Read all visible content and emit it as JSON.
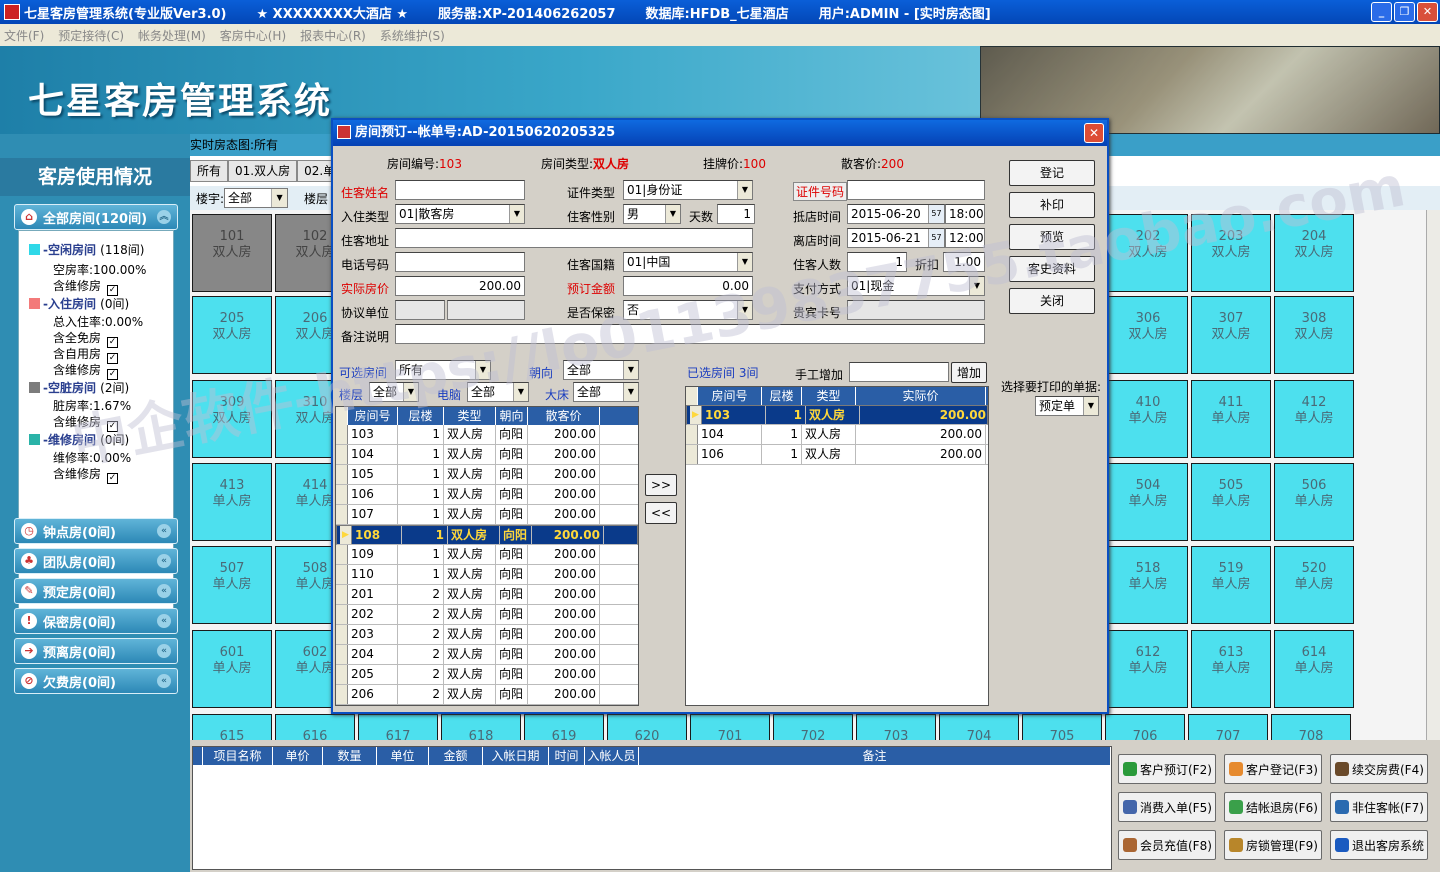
{
  "window": {
    "app_title": "七星客房管理系统(专业版Ver3.0)",
    "hotel": "★ XXXXXXXX大酒店 ★",
    "server": "服务器:XP-201406262057",
    "database": "数据库:HFDB_七星酒店",
    "user": "用户:ADMIN - [实时房态图]",
    "min": "_",
    "max": "❐",
    "close": "✕"
  },
  "menu": [
    "文件(F)",
    "预定接待(C)",
    "帐务处理(M)",
    "客房中心(H)",
    "报表中心(R)",
    "系统维护(S)"
  ],
  "banner_title": "七星客房管理系统",
  "sidebar": {
    "header": "客房使用情况",
    "all_rooms": "全部房间(120间)",
    "stats": {
      "vacant": "-空闲房间",
      "vacant_count": "(118间)",
      "vacant_rate": "空房率:100.00%",
      "vacant_repair": "含维修房",
      "occupied": "-入住房间",
      "occupied_count": "(0间)",
      "occupied_rate": "总入住率:0.00%",
      "free": "含全免房",
      "self": "含自用房",
      "occ_repair": "含维修房",
      "dirty": "-空脏房间",
      "dirty_count": "(2间)",
      "dirty_rate": "脏房率:1.67%",
      "dirty_repair": "含维修房",
      "repair": "-维修房间",
      "repair_count": "(0间)",
      "repair_rate": "维修率:0.00%",
      "repair_repair": "含维修房"
    },
    "groups": [
      "钟点房(0间)",
      "团队房(0间)",
      "预定房(0间)",
      "保密房(0间)",
      "预离房(0间)",
      "欠费房(0间)"
    ]
  },
  "main": {
    "crumb": "实时房态图:所有",
    "tabs": [
      "所有",
      "01.双人房",
      "02.单"
    ],
    "building_label": "楼宇:",
    "building_value": "全部",
    "floor_label": "楼层"
  },
  "rooms": [
    {
      "no": "101",
      "type": "双人房"
    },
    {
      "no": "102",
      "type": "双人房"
    },
    {
      "no": "202",
      "type": "双人房"
    },
    {
      "no": "203",
      "type": "双人房"
    },
    {
      "no": "204",
      "type": "双人房"
    },
    {
      "no": "205",
      "type": "双人房"
    },
    {
      "no": "206",
      "type": "双人房"
    },
    {
      "no": "306",
      "type": "双人房"
    },
    {
      "no": "307",
      "type": "双人房"
    },
    {
      "no": "308",
      "type": "双人房"
    },
    {
      "no": "309",
      "type": "双人房"
    },
    {
      "no": "310",
      "type": "双人房"
    },
    {
      "no": "410",
      "type": "单人房"
    },
    {
      "no": "411",
      "type": "单人房"
    },
    {
      "no": "412",
      "type": "单人房"
    },
    {
      "no": "413",
      "type": "单人房"
    },
    {
      "no": "414",
      "type": "单人房"
    },
    {
      "no": "504",
      "type": "单人房"
    },
    {
      "no": "505",
      "type": "单人房"
    },
    {
      "no": "506",
      "type": "单人房"
    },
    {
      "no": "507",
      "type": "单人房"
    },
    {
      "no": "508",
      "type": "单人房"
    },
    {
      "no": "518",
      "type": "单人房"
    },
    {
      "no": "519",
      "type": "单人房"
    },
    {
      "no": "520",
      "type": "单人房"
    },
    {
      "no": "601",
      "type": "单人房"
    },
    {
      "no": "602",
      "type": "单人房"
    },
    {
      "no": "612",
      "type": "单人房"
    },
    {
      "no": "613",
      "type": "单人房"
    },
    {
      "no": "614",
      "type": "单人房"
    },
    {
      "no": "615",
      "type": ""
    },
    {
      "no": "616",
      "type": ""
    },
    {
      "no": "617",
      "type": ""
    },
    {
      "no": "618",
      "type": ""
    },
    {
      "no": "619",
      "type": ""
    },
    {
      "no": "620",
      "type": ""
    },
    {
      "no": "701",
      "type": ""
    },
    {
      "no": "702",
      "type": ""
    },
    {
      "no": "703",
      "type": ""
    },
    {
      "no": "704",
      "type": ""
    },
    {
      "no": "705",
      "type": ""
    },
    {
      "no": "706",
      "type": ""
    },
    {
      "no": "707",
      "type": ""
    },
    {
      "no": "708",
      "type": ""
    }
  ],
  "dialog": {
    "title": "房间预订--帐单号:AD-20150620205325",
    "close": "✕",
    "room_no_label": "房间编号:",
    "room_no": "103",
    "room_type_label": "房间类型:",
    "room_type": "双人房",
    "list_price_label": "挂牌价:",
    "list_price": "100",
    "walkin_price_label": "散客价:",
    "walkin_price": "200",
    "guest_name": "住客姓名",
    "id_type": "证件类型",
    "id_type_val": "01|身份证",
    "id_no": "证件号码",
    "checkin_type": "入住类型",
    "checkin_type_val": "01|散客房",
    "gender": "住客性别",
    "gender_val": "男",
    "days": "天数",
    "days_val": "1",
    "arrive": "抵店时间",
    "arrive_date": "2015-06-20",
    "arrive_time": "18:00",
    "address": "住客地址",
    "depart": "离店时间",
    "depart_date": "2015-06-21",
    "depart_time": "12:00",
    "phone": "电话号码",
    "nation": "住客国籍",
    "nation_val": "01|中国",
    "guests": "住客人数",
    "guests_val": "1",
    "discount": "折扣",
    "discount_val": "1.00",
    "price": "实际房价",
    "price_val": "200.00",
    "deposit": "预订金额",
    "deposit_val": "0.00",
    "pay": "支付方式",
    "pay_val": "01|现金",
    "unit": "协议单位",
    "secret": "是否保密",
    "secret_val": "否",
    "vip": "贵宾卡号",
    "remark": "备注说明",
    "cal_icon": "57",
    "buttons": [
      "登记",
      "补印",
      "预览",
      "客史资料",
      "关闭"
    ],
    "print_label": "选择要打印的单据:",
    "print_val": "预定单",
    "avail": "可选房间",
    "avail_val": "所有",
    "facing": "朝向",
    "facing_val": "全部",
    "floor": "楼层",
    "floor_val": "全部",
    "tv": "电脑",
    "tv_val": "全部",
    "bed": "大床",
    "bed_val": "全部",
    "selected": "已选房间 3间",
    "manual": "手工增加",
    "add": "增加",
    "move_right": ">>",
    "move_left": "<<",
    "left_cols": [
      "房间号",
      "层楼",
      "类型",
      "朝向",
      "散客价"
    ],
    "left_rows": [
      [
        "103",
        "1",
        "双人房",
        "向阳",
        "200.00"
      ],
      [
        "104",
        "1",
        "双人房",
        "向阳",
        "200.00"
      ],
      [
        "105",
        "1",
        "双人房",
        "向阳",
        "200.00"
      ],
      [
        "106",
        "1",
        "双人房",
        "向阳",
        "200.00"
      ],
      [
        "107",
        "1",
        "双人房",
        "向阳",
        "200.00"
      ],
      [
        "108",
        "1",
        "双人房",
        "向阳",
        "200.00"
      ],
      [
        "109",
        "1",
        "双人房",
        "向阳",
        "200.00"
      ],
      [
        "110",
        "1",
        "双人房",
        "向阳",
        "200.00"
      ],
      [
        "201",
        "2",
        "双人房",
        "向阳",
        "200.00"
      ],
      [
        "202",
        "2",
        "双人房",
        "向阳",
        "200.00"
      ],
      [
        "203",
        "2",
        "双人房",
        "向阳",
        "200.00"
      ],
      [
        "204",
        "2",
        "双人房",
        "向阳",
        "200.00"
      ],
      [
        "205",
        "2",
        "双人房",
        "向阳",
        "200.00"
      ],
      [
        "206",
        "2",
        "双人房",
        "向阳",
        "200.00"
      ]
    ],
    "right_cols": [
      "房间号",
      "层楼",
      "类型",
      "实际价"
    ],
    "right_rows": [
      [
        "103",
        "1",
        "双人房",
        "200.00"
      ],
      [
        "104",
        "1",
        "双人房",
        "200.00"
      ],
      [
        "106",
        "1",
        "双人房",
        "200.00"
      ]
    ]
  },
  "bill": {
    "cols": [
      "项目名称",
      "单价",
      "数量",
      "单位",
      "金额",
      "入帐日期",
      "时间",
      "入帐人员",
      "备注"
    ]
  },
  "actions": [
    "客户预订(F2)",
    "客户登记(F3)",
    "续交房费(F4)",
    "消费入单(F5)",
    "结帐退房(F6)",
    "非住客帐(F7)",
    "会员充值(F8)",
    "房锁管理(F9)",
    "退出客房系统"
  ],
  "watermark": "中企软件-https://lo01139837755.taobao.com"
}
